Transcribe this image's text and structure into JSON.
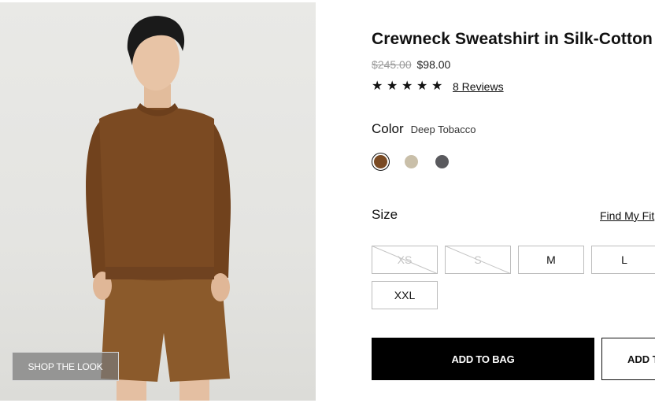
{
  "product": {
    "title": "Crewneck Sweatshirt in Silk-Cotton",
    "price_original": "$245.00",
    "price_sale": "$98.00",
    "rating": {
      "stars": 5,
      "filled": 5,
      "reviews_label": "8 Reviews"
    }
  },
  "color": {
    "label": "Color",
    "selected_name": "Deep Tobacco",
    "swatches": [
      {
        "name": "deep-tobacco",
        "hex": "#7a4a23",
        "selected": true
      },
      {
        "name": "beige",
        "hex": "#c9bfa9",
        "selected": false
      },
      {
        "name": "charcoal",
        "hex": "#5a5a5e",
        "selected": false
      }
    ]
  },
  "size": {
    "label": "Size",
    "find_fit_label": "Find My Fit",
    "options": [
      {
        "label": "XS",
        "available": false
      },
      {
        "label": "S",
        "available": false
      },
      {
        "label": "M",
        "available": true
      },
      {
        "label": "L",
        "available": true
      },
      {
        "label": "XXL",
        "available": true
      }
    ]
  },
  "actions": {
    "add_to_bag": "ADD TO BAG",
    "add_second": "ADD TO"
  },
  "image": {
    "shop_the_look": "SHOP THE LOOK",
    "colors": {
      "sweater": "#7b4a22",
      "shorts": "#8b5a2b",
      "skin": "#e8c4a6",
      "hair": "#1a1a1a"
    }
  }
}
